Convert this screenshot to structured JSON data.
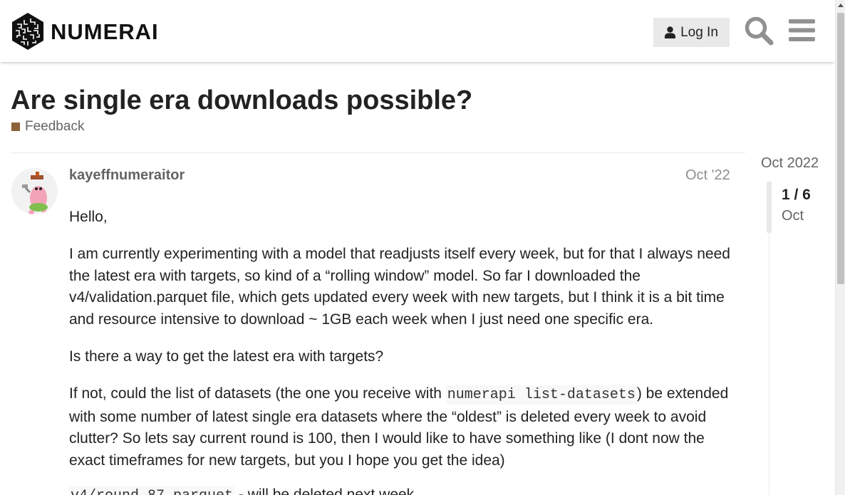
{
  "header": {
    "logo_text": "NUMERAI",
    "login_label": "Log In",
    "icons": [
      "numerai-logo-icon",
      "user-icon",
      "search-icon",
      "hamburger-menu-icon"
    ]
  },
  "topic": {
    "title": "Are single era downloads possible?",
    "category": "Feedback",
    "category_color": "#8c6238"
  },
  "post": {
    "username": "kayeffnumeraitor",
    "date": "Oct '22",
    "p1": "Hello,",
    "p2": "I am currently experimenting with a model that readjusts itself every week, but for that I always need the latest era with targets, so kind of a “rolling window” model. So far I downloaded the v4/validation.parquet file, which gets updated every week with new targets, but I think it is a bit time and resource intensive to download ~ 1GB each week when I just need one specific era.",
    "p3": "Is there a way to get the latest era with targets?",
    "p4_before": "If not, could the list of datasets (the one you receive with ",
    "p4_code": "numerapi list-datasets",
    "p4_after": ") be extended with some number of latest single era datasets where the “oldest” is deleted every week to avoid clutter? So lets say current round is 100, then I would like to have something like (I dont now the exact timeframes for new targets, but you I hope you get the idea)",
    "p5_code": "v4/round_87.parquet",
    "p5_after": " - will be deleted next week"
  },
  "timeline": {
    "start_label": "Oct 2022",
    "position": "1 / 6",
    "current_date": "Oct"
  }
}
